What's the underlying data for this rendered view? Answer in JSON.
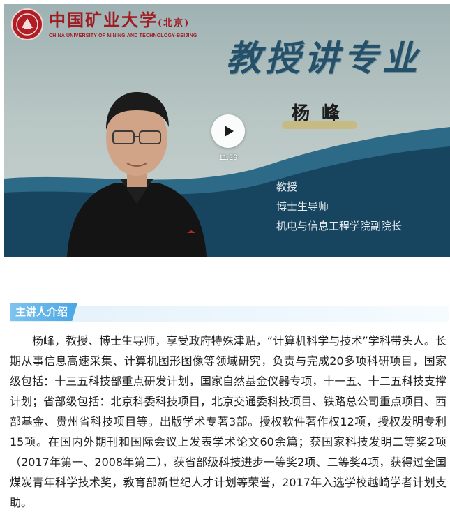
{
  "video": {
    "logo": {
      "cn_name": "中国矿业大学",
      "cn_suffix": "(北京)",
      "en_name": "CHINA UNIVERSITY OF MINING AND TECHNOLOGY-BEIJING"
    },
    "slogan": "教授讲专业",
    "speaker_name": "杨 峰",
    "speaker_titles": [
      "教授",
      "博士生导师",
      "机电与信息工程学院副院长"
    ],
    "duration": "11:29",
    "colors": {
      "wave_dark": "#17455f",
      "wave_light": "#2d6a87",
      "brand_red": "#a11c22"
    }
  },
  "section": {
    "title": "主讲人介绍",
    "accent": "#4aa6e4"
  },
  "bio": "杨峰，教授、博士生导师，享受政府特殊津贴，“计算机科学与技术”学科带头人。长期从事信息高速采集、计算机图形图像等领域研究，负责与完成20多项科研项目，国家级包括：十三五科技部重点研发计划，国家自然基金仪器专项，十一五、十二五科技支撑计划；省部级包括：北京科委科技项目，北京交通委科技项目、铁路总公司重点项目、西部基金、贵州省科技项目等。出版学术专著3部。授权软件著作权12项，授权发明专利15项。在国内外期刊和国际会议上发表学术论文60余篇；获国家科技发明二等奖2项（2017年第一、2008年第二），获省部级科技进步一等奖2项、二等奖4项，获得过全国煤炭青年科学技术奖，教育部新世纪人才计划等荣誉，2017年入选学校越崎学者计划支助。"
}
